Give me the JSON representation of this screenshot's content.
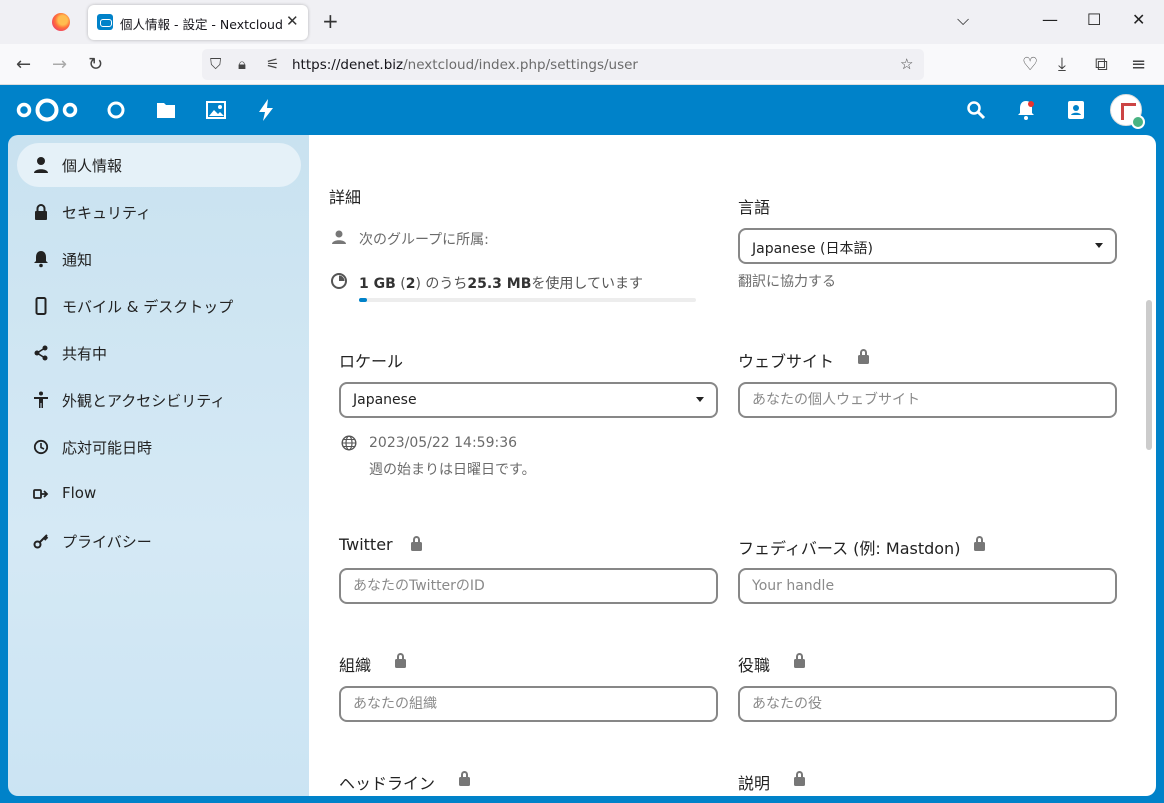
{
  "browser": {
    "tab_title": "個人情報 - 設定 - Nextcloud",
    "url_host": "https://denet.biz",
    "url_path": "/nextcloud/index.php/settings/user"
  },
  "sidebar": {
    "items": [
      {
        "label": "個人情報",
        "icon": "user-icon",
        "active": true
      },
      {
        "label": "セキュリティ",
        "icon": "lock-icon"
      },
      {
        "label": "通知",
        "icon": "bell-icon"
      },
      {
        "label": "モバイル & デスクトップ",
        "icon": "phone-icon"
      },
      {
        "label": "共有中",
        "icon": "share-icon"
      },
      {
        "label": "外観とアクセシビリティ",
        "icon": "accessibility-icon"
      },
      {
        "label": "応対可能日時",
        "icon": "clock-icon"
      },
      {
        "label": "Flow",
        "icon": "flow-icon"
      },
      {
        "label": "プライバシー",
        "icon": "key-icon"
      }
    ]
  },
  "details": {
    "title": "詳細",
    "groups_label": "次のグループに所属:",
    "quota_total": "1 GB",
    "quota_paren_open": " (",
    "quota_groups": "2",
    "quota_mid": ") のうち",
    "quota_used": "25.3 MB",
    "quota_suffix": "を使用しています",
    "quota_fraction": 0.025
  },
  "language": {
    "title": "言語",
    "value": "Japanese (日本語)",
    "help_link": "翻訳に協力する"
  },
  "locale": {
    "title": "ロケール",
    "value": "Japanese",
    "datetime": "2023/05/22 14:59:36",
    "week_start": "週の始まりは日曜日です。"
  },
  "website": {
    "title": "ウェブサイト",
    "placeholder": "あなたの個人ウェブサイト"
  },
  "twitter": {
    "title": "Twitter",
    "placeholder": "あなたのTwitterのID"
  },
  "fediverse": {
    "title": "フェディバース (例: Mastdon)",
    "placeholder": "Your handle"
  },
  "organisation": {
    "title": "組織",
    "placeholder": "あなたの組織"
  },
  "role": {
    "title": "役職",
    "placeholder": "あなたの役"
  },
  "headline": {
    "title": "ヘッドライン"
  },
  "biography": {
    "title": "説明"
  },
  "colors": {
    "brand": "#0082c9",
    "online": "#49b382"
  }
}
